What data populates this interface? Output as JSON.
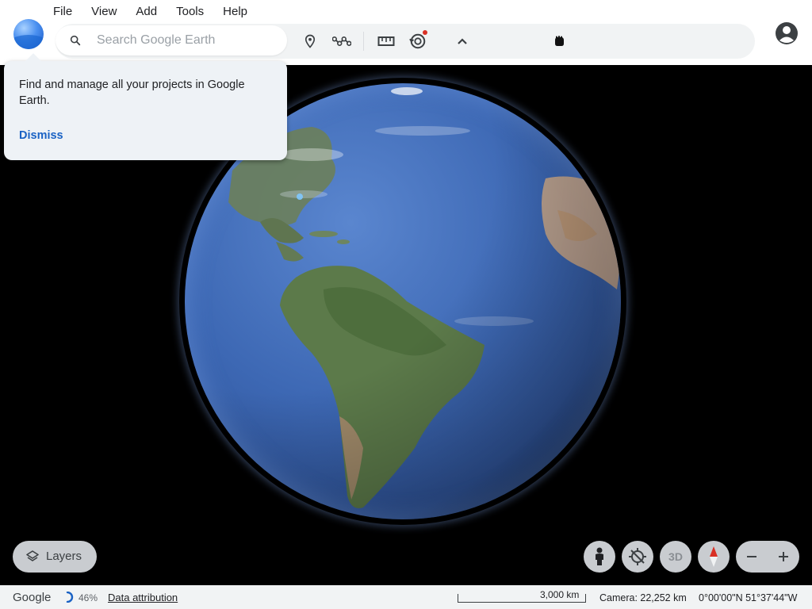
{
  "menu": {
    "items": [
      "File",
      "View",
      "Add",
      "Tools",
      "Help"
    ]
  },
  "search": {
    "placeholder": "Search Google Earth",
    "value": ""
  },
  "toolbar": {
    "icons": [
      "place-marker-icon",
      "path-icon",
      "measure-ruler-icon",
      "voyager-icon",
      "collapse-chevron-icon",
      "hand-cursor-icon"
    ],
    "notification_dot_color": "#d93025"
  },
  "popup": {
    "text": "Find and manage all your projects in Google Earth.",
    "dismiss_label": "Dismiss"
  },
  "controls": {
    "layers_label": "Layers",
    "three_d_label": "3D"
  },
  "status": {
    "brand": "Google",
    "progress_percent": "46%",
    "attribution": "Data attribution",
    "scale_label": "3,000 km",
    "camera": "Camera: 22,252 km",
    "coordinates": "0°00'00\"N 51°37'44\"W"
  },
  "colors": {
    "header_bg": "#ffffff",
    "toolbar_bg": "#f1f3f4",
    "accent": "#1a62c4",
    "control_bg": "#c9ccd0",
    "space": "#000000"
  }
}
